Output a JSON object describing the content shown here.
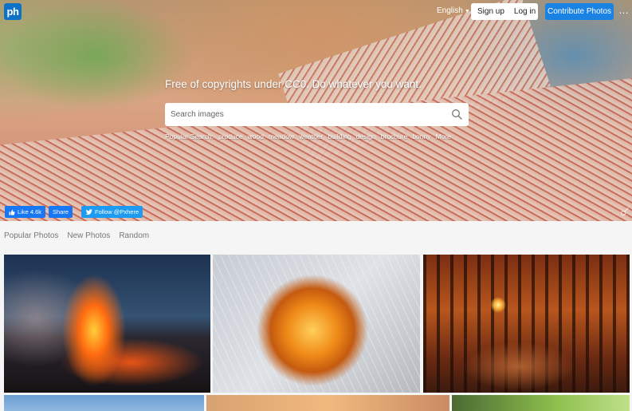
{
  "header": {
    "logo_text": "ph",
    "language": "English",
    "signup_label": "Sign up",
    "login_label": "Log in",
    "contribute_label": "Contribute Photos",
    "more_label": "…"
  },
  "hero": {
    "tagline": "Free of copyrights under CC0. Do whatever you want.",
    "search_placeholder": "Search images",
    "popular_label": "Popular Search:",
    "popular_items": [
      "produce",
      "wood",
      "meadow",
      "weather",
      "building",
      "design",
      "brochure",
      "bonny",
      "More"
    ]
  },
  "social": {
    "like_label": "Like 4.6k",
    "share_label": "Share",
    "follow_label": "Follow @Pxhere"
  },
  "tabs": [
    "Popular Photos",
    "New Photos",
    "Random"
  ],
  "colors": {
    "brand_blue": "#0e72c6",
    "contribute_blue": "#1a82e2",
    "facebook_blue": "#1877f2",
    "twitter_blue": "#1d9bf0"
  }
}
